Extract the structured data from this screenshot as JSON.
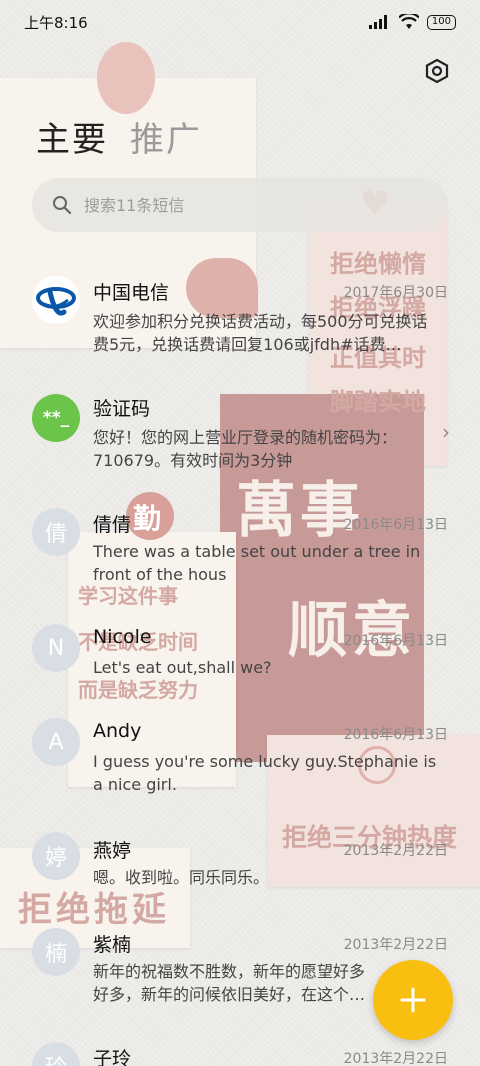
{
  "status_bar": {
    "time": "上午8:16",
    "battery": "100"
  },
  "tabs": [
    {
      "label": "主要",
      "active": true
    },
    {
      "label": "推广",
      "active": false
    }
  ],
  "search": {
    "placeholder": "搜索11条短信"
  },
  "wallpaper": {
    "big_chars_1": "萬事",
    "big_chars_2": "顺意",
    "qin": "勤",
    "mottos": [
      "拒绝懒惰",
      "拒绝浮躁",
      "正值其时",
      "脚踏实地"
    ],
    "study": [
      "学习这件事",
      "不是缺乏时间",
      "而是缺乏努力"
    ],
    "refuse_three": "拒绝三分钟热度",
    "refuse_delay": "拒绝拖延"
  },
  "messages": [
    {
      "name": "中国电信",
      "date": "2017年6月30日",
      "preview": "欢迎参加积分兑换话费活动，每500分可兑换话费5元，兑换话费请回复106或jfdh#话费…",
      "avatar_type": "logo"
    },
    {
      "name": "验证码",
      "date": "",
      "preview": "您好！您的网上营业厅登录的随机密码为：710679。有效时间为3分钟",
      "avatar_type": "code",
      "avatar_text": "**_"
    },
    {
      "name": "倩倩",
      "date": "2016年6月13日",
      "preview": "There was a table set out under a tree in front of the hous",
      "avatar_text": "倩"
    },
    {
      "name": "Nicole",
      "date": "2016年6月13日",
      "preview": "Let's eat out,shall we?",
      "avatar_text": "N"
    },
    {
      "name": "Andy",
      "date": "2016年6月13日",
      "preview": "I guess you're some lucky guy.Stephanie is a nice girl.",
      "avatar_text": "A"
    },
    {
      "name": "燕婷",
      "date": "2013年2月22日",
      "preview": "嗯。收到啦。同乐同乐。",
      "avatar_text": "婷"
    },
    {
      "name": "紫楠",
      "date": "2013年2月22日",
      "preview": "新年的祝福数不胜数，新年的愿望好多好多，新年的问候依旧美好，在这个温馨的",
      "avatar_text": "楠"
    },
    {
      "name": "子玲",
      "date": "2013年2月22日",
      "preview": "",
      "avatar_text": "玲"
    }
  ],
  "colors": {
    "fab": "#f8be10",
    "code_avatar": "#6cc54b",
    "telecom_blue": "#0a56a8"
  }
}
